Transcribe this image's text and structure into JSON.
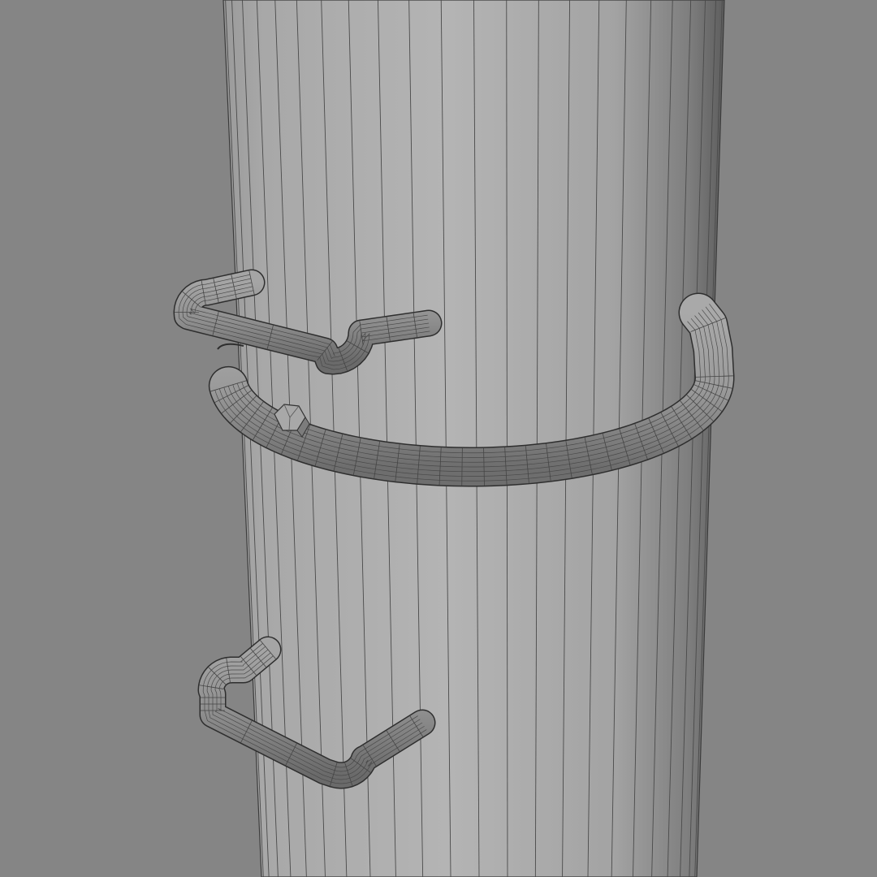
{
  "viewport": {
    "background_color": "#858585",
    "pole_color_light": "#b3b3b3",
    "pole_color_mid": "#9a9a9a",
    "pole_color_dark": "#6a6a6a",
    "wire_color": "#3a3a3a",
    "rung_color": "#8c8c8c",
    "clamp_color": "#909090"
  },
  "scene": {
    "objects": [
      {
        "name": "pole",
        "icon": "cylinder-mesh"
      },
      {
        "name": "clamp-band",
        "icon": "torus-band-mesh"
      },
      {
        "name": "bolt-head",
        "icon": "hexagon-bolt"
      },
      {
        "name": "upper-rung",
        "icon": "u-bar-mesh"
      },
      {
        "name": "lower-rung",
        "icon": "u-bar-mesh"
      }
    ]
  }
}
